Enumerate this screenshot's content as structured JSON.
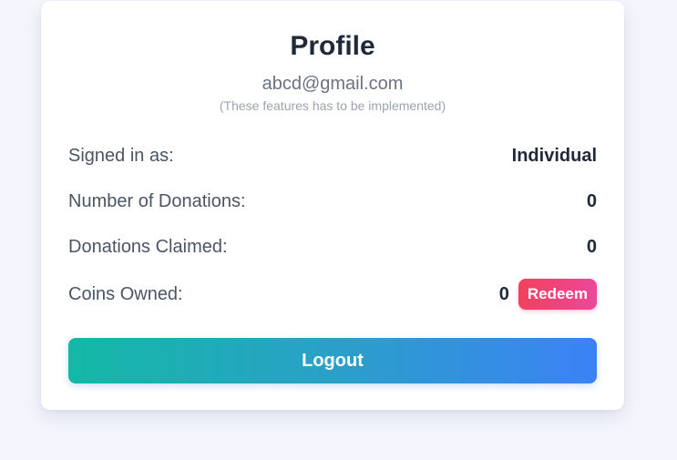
{
  "profile": {
    "title": "Profile",
    "email": "abcd@gmail.com",
    "note": "(These features has to be implemented)"
  },
  "stats": {
    "signed_in": {
      "label": "Signed in as:",
      "value": "Individual"
    },
    "donations": {
      "label": "Number of Donations:",
      "value": "0"
    },
    "claimed": {
      "label": "Donations Claimed:",
      "value": "0"
    },
    "coins": {
      "label": "Coins Owned:",
      "value": "0"
    }
  },
  "actions": {
    "redeem_label": "Redeem",
    "logout_label": "Logout"
  },
  "colors": {
    "page_background": "#f4f5fd",
    "card_background": "#ffffff",
    "redeem_gradient": [
      "#f43f5e",
      "#ec4899"
    ],
    "logout_gradient": [
      "#14b8a6",
      "#3b82f6"
    ]
  }
}
